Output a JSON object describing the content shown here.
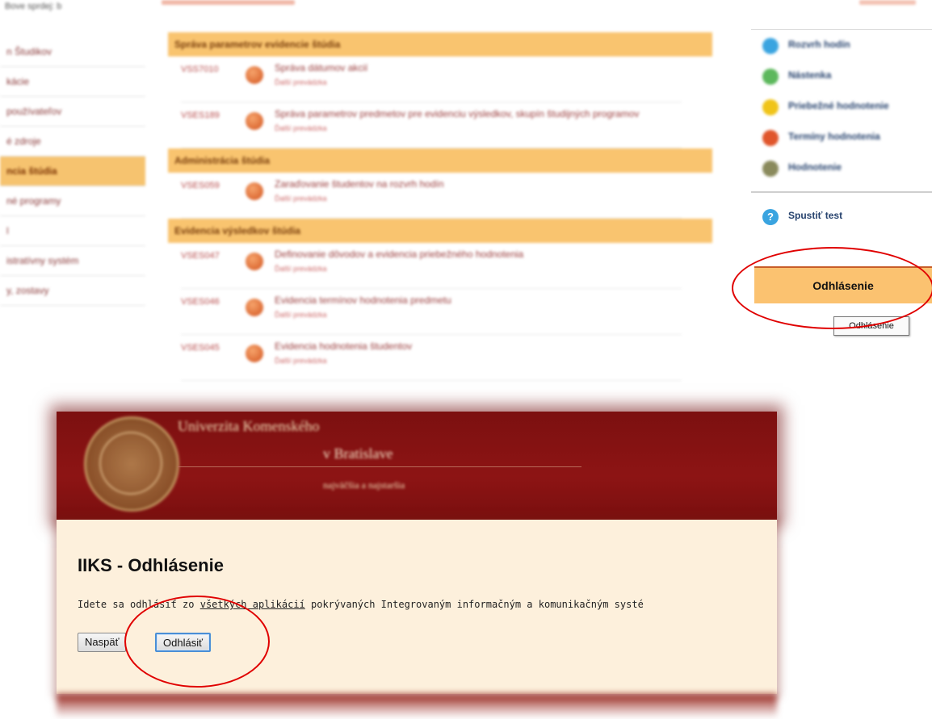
{
  "top": {
    "left_text": "Bove sprdej: b"
  },
  "sidebar": {
    "items": [
      {
        "label": "n Študikov",
        "active": false
      },
      {
        "label": "kácie",
        "active": false
      },
      {
        "label": "používateľov",
        "active": false
      },
      {
        "label": "é zdroje",
        "active": false
      },
      {
        "label": "ncia štúdia",
        "active": true
      },
      {
        "label": "né programy",
        "active": false
      },
      {
        "label": "l",
        "active": false
      },
      {
        "label": "istratívny systém",
        "active": false
      },
      {
        "label": "y, zostavy",
        "active": false
      }
    ]
  },
  "main": {
    "sections": [
      {
        "title": "Správa parametrov evidencie štúdia",
        "entries": [
          {
            "code": "VSS7010",
            "title": "Správa dátumov akcií",
            "sub": "Ďalší prevádzka"
          },
          {
            "code": "VSES189",
            "title": "Správa parametrov predmetov pre evidenciu výsledkov, skupín študijných programov",
            "sub": "Ďalší prevádzka"
          }
        ]
      },
      {
        "title": "Administrácia štúdia",
        "entries": [
          {
            "code": "VSES059",
            "title": "Zaraďovanie študentov na rozvrh hodín",
            "sub": "Ďalší prevádzka"
          }
        ]
      },
      {
        "title": "Evidencia výsledkov štúdia",
        "entries": [
          {
            "code": "VSES047",
            "title": "Definovanie dôvodov a evidencia priebežného hodnotenia",
            "sub": "Ďalší prevádzka"
          },
          {
            "code": "VSES046",
            "title": "Evidencia termínov hodnotenia predmetu",
            "sub": "Ďalší prevádzka"
          },
          {
            "code": "VSES045",
            "title": "Evidencia hodnotenia študentov",
            "sub": "Ďalší prevádzka"
          }
        ]
      }
    ]
  },
  "right_menu": {
    "items": [
      {
        "label": "Rozvrh hodín",
        "icon": "calendar-icon",
        "color": "#3aa4e0"
      },
      {
        "label": "Nástenka",
        "icon": "board-icon",
        "color": "#5cb85c"
      },
      {
        "label": "Priebežné hodnotenie",
        "icon": "progress-icon",
        "color": "#f0c419"
      },
      {
        "label": "Termíny hodnotenia",
        "icon": "deadline-icon",
        "color": "#e0552b"
      },
      {
        "label": "Hodnotenie",
        "icon": "grade-icon",
        "color": "#8a8a5c"
      }
    ],
    "test_label": "Spustiť test",
    "test_icon": "help-icon",
    "logout_label": "Odhlásenie",
    "tooltip": "Odhlásenie"
  },
  "overlay": {
    "banner": {
      "line1": "Univerzita Komenského",
      "line2": "v Bratislave",
      "line3": "najväčšia a najstaršia"
    },
    "title": "IIKS - Odhlásenie",
    "text_before": "Idete sa odhlásiť zo ",
    "text_link": "všetkých aplikácií",
    "text_after": " pokrývaných Integrovaným informačným a komunikačným systé",
    "back_label": "Naspäť",
    "logout_label": "Odhlásiť"
  },
  "colors": {
    "section_header": "#f9c46f",
    "banner": "#8d1414",
    "panel": "#fdf0dc",
    "highlight": "#e00000"
  }
}
